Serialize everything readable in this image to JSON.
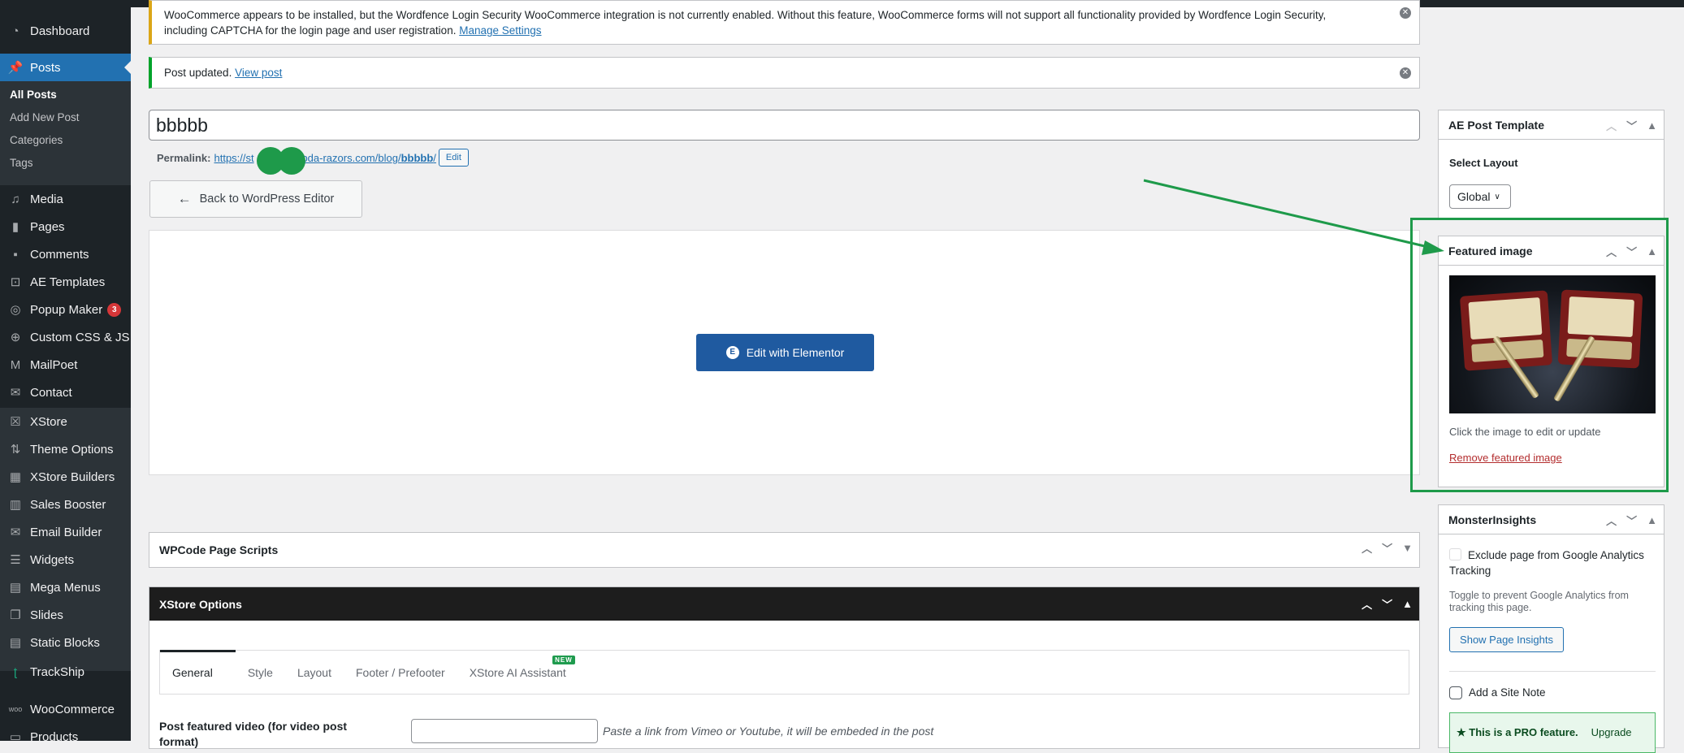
{
  "sidebar": {
    "items": [
      {
        "label": "Dashboard",
        "icon": "dashboard-icon"
      },
      {
        "label": "Posts",
        "icon": "pin-icon",
        "active": true
      },
      {
        "label": "Media",
        "icon": "media-icon"
      },
      {
        "label": "Pages",
        "icon": "pages-icon"
      },
      {
        "label": "Comments",
        "icon": "comments-icon"
      },
      {
        "label": "AE Templates",
        "icon": "ae-templates-icon"
      },
      {
        "label": "Popup Maker",
        "icon": "popup-maker-icon",
        "badge": "3"
      },
      {
        "label": "Custom CSS & JS",
        "icon": "plus-circle-icon"
      },
      {
        "label": "MailPoet",
        "icon": "mailpoet-icon"
      },
      {
        "label": "Contact",
        "icon": "envelope-icon"
      },
      {
        "label": "XStore",
        "icon": "xstore-icon"
      },
      {
        "label": "Theme Options",
        "icon": "sliders-icon"
      },
      {
        "label": "XStore Builders",
        "icon": "builders-icon"
      },
      {
        "label": "Sales Booster",
        "icon": "bar-chart-icon"
      },
      {
        "label": "Email Builder",
        "icon": "email-icon"
      },
      {
        "label": "Widgets",
        "icon": "widgets-icon"
      },
      {
        "label": "Mega Menus",
        "icon": "mega-menu-icon"
      },
      {
        "label": "Slides",
        "icon": "slides-icon"
      },
      {
        "label": "Static Blocks",
        "icon": "static-blocks-icon"
      },
      {
        "label": "TrackShip",
        "icon": "trackship-icon"
      },
      {
        "label": "WooCommerce",
        "icon": "woo-icon"
      },
      {
        "label": "Products",
        "icon": "products-icon"
      }
    ],
    "submenu": [
      "All Posts",
      "Add New Post",
      "Categories",
      "Tags"
    ]
  },
  "notices": {
    "woo": {
      "text": "WooCommerce appears to be installed, but the Wordfence Login Security WooCommerce integration is not currently enabled. Without this feature, WooCommerce forms will not support all functionality provided by Wordfence Login Security, including CAPTCHA for the login page and user registration.",
      "link": "Manage Settings",
      "color": "#dba617"
    },
    "updated": {
      "text": "Post updated.",
      "link": "View post",
      "color": "#00a32a"
    }
  },
  "post": {
    "title": "bbbbb",
    "permalink_label": "Permalink:",
    "permalink_prefix": "https://st",
    "permalink_mid": "mbda-razors.com/blog/",
    "permalink_slug": "bbbbb",
    "permalink_suffix": "/",
    "edit_label": "Edit"
  },
  "back_button": "Back to WordPress Editor",
  "elementor_button": "Edit with Elementor",
  "panels": {
    "wpcode": "WPCode Page Scripts",
    "xstore": {
      "title": "XStore Options",
      "tabs": [
        "General",
        "Style",
        "Layout",
        "Footer / Prefooter",
        "XStore AI Assistant"
      ],
      "new_badge": "NEW",
      "video_label": "Post featured video (for video post format)",
      "video_value": "",
      "video_hint": "Paste a link from Vimeo or Youtube, it will be embeded in the post"
    }
  },
  "side": {
    "ae": {
      "title": "AE Post Template",
      "label": "Select Layout",
      "value": "Global"
    },
    "featured": {
      "title": "Featured image",
      "hint": "Click the image to edit or update",
      "remove": "Remove featured image",
      "image_alt": "two safety razors in red wooden cases"
    },
    "monster": {
      "title": "MonsterInsights",
      "exclude": "Exclude page from Google Analytics Tracking",
      "toggle_hint": "Toggle to prevent Google Analytics from tracking this page.",
      "show_insights": "Show Page Insights",
      "site_note": "Add a Site Note",
      "pro": "This is a PRO feature.",
      "upgrade": "Upgrade"
    }
  },
  "annotation": {
    "color": "#1e9a4a"
  }
}
